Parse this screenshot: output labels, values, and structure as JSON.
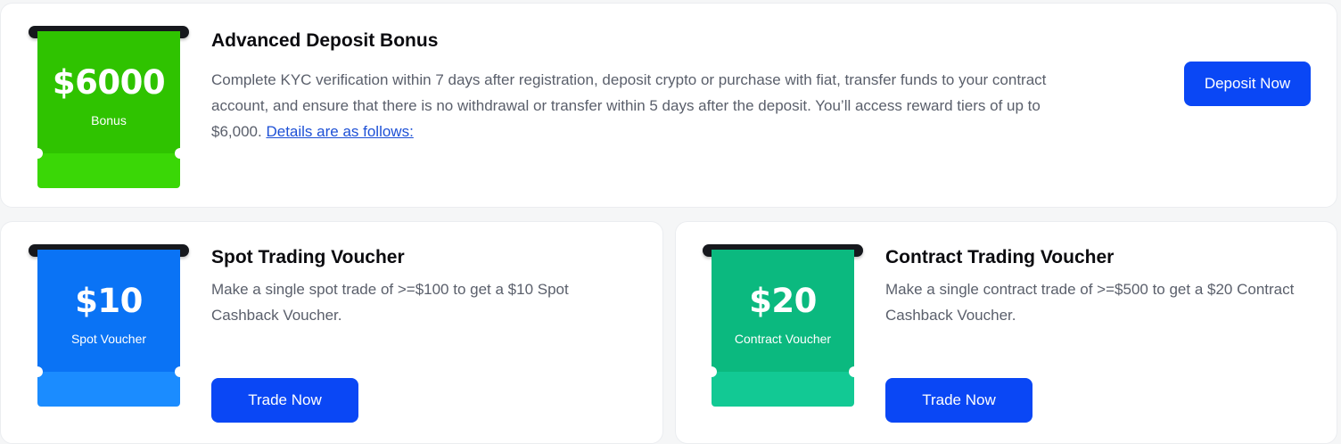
{
  "deposit_bonus": {
    "ticket_amount": "$6000",
    "ticket_label": "Bonus",
    "title": "Advanced Deposit Bonus",
    "description": "Complete KYC verification within 7 days after registration, deposit crypto or purchase with fiat, transfer funds to your contract account, and ensure that there is no withdrawal or transfer within 5 days after the deposit. You’ll access reward tiers of up to $6,000.",
    "details_link": "Details are as follows:",
    "button_label": "Deposit Now"
  },
  "spot_voucher": {
    "ticket_amount": "$10",
    "ticket_label": "Spot Voucher",
    "title": "Spot Trading Voucher",
    "description": "Make a single spot trade of >=$100 to get a $10 Spot Cashback Voucher.",
    "button_label": "Trade Now"
  },
  "contract_voucher": {
    "ticket_amount": "$20",
    "ticket_label": "Contract Voucher",
    "title": "Contract Trading Voucher",
    "description": "Make a single contract trade of >=$500 to get a $20 Contract Cashback Voucher.",
    "button_label": "Trade Now"
  },
  "colors": {
    "button": "#0a47f5",
    "bonus_green": "#2fc300",
    "spot_blue": "#0a73f5",
    "contract_teal": "#0bb97f"
  }
}
